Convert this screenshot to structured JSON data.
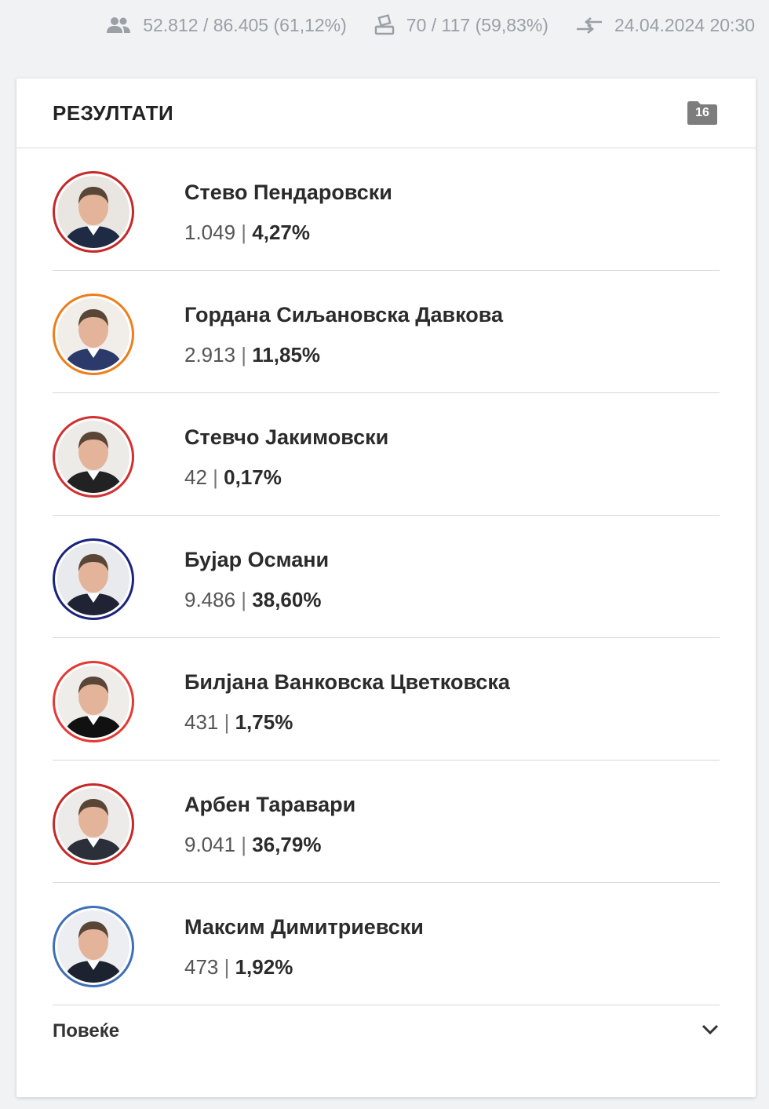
{
  "stats": {
    "voters": "52.812 / 86.405 (61,12%)",
    "voters_icon": "people-icon",
    "stations": "70 / 117 (59,83%)",
    "stations_icon": "ballot-box-icon",
    "updated": "24.04.2024 20:30",
    "updated_icon": "swap-arrows-icon"
  },
  "results": {
    "title": "РЕЗУЛТАТИ",
    "badge_count": "16",
    "badge_icon": "folder-icon",
    "more_label": "Повеќе",
    "more_icon": "chevron-down-icon"
  },
  "candidates": [
    {
      "name": "Стево Пендаровски",
      "votes": "1.049",
      "separator": " | ",
      "percent": "4,27%",
      "ring_color": "#c62828",
      "photo_bg": "#e9e6e2",
      "suit_color": "#1f2a44"
    },
    {
      "name": "Гордана Сиљановска Давкова",
      "votes": "2.913",
      "separator": " | ",
      "percent": "11,85%",
      "ring_color": "#ef7d1a",
      "photo_bg": "#f1eee9",
      "suit_color": "#2b3a6b"
    },
    {
      "name": "Стевчо Јакимовски",
      "votes": "42",
      "separator": " | ",
      "percent": "0,17%",
      "ring_color": "#d32f2f",
      "photo_bg": "#ecebe8",
      "suit_color": "#222222"
    },
    {
      "name": "Бујар Османи",
      "votes": "9.486",
      "separator": " | ",
      "percent": "38,60%",
      "ring_color": "#1a237e",
      "photo_bg": "#e8eaed",
      "suit_color": "#1f2333"
    },
    {
      "name": "Билјана Ванковска Цветковска",
      "votes": "431",
      "separator": " | ",
      "percent": "1,75%",
      "ring_color": "#e53935",
      "photo_bg": "#efedea",
      "suit_color": "#111111"
    },
    {
      "name": "Арбен Таравари",
      "votes": "9.041",
      "separator": " | ",
      "percent": "36,79%",
      "ring_color": "#c62828",
      "photo_bg": "#ecebe9",
      "suit_color": "#2a2f3a"
    },
    {
      "name": "Максим Димитриевски",
      "votes": "473",
      "separator": " | ",
      "percent": "1,92%",
      "ring_color": "#3f6fb6",
      "photo_bg": "#eceef1",
      "suit_color": "#1d2230"
    }
  ]
}
